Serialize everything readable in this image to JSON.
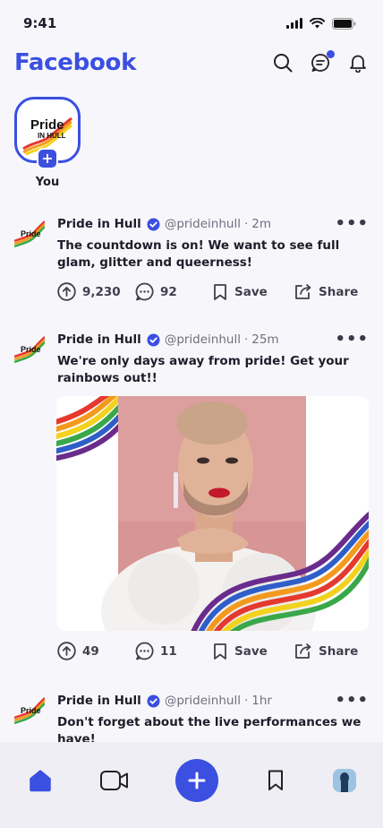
{
  "status": {
    "time": "9:41"
  },
  "header": {
    "brand": "Facebook",
    "icons": [
      "search-icon",
      "messages-icon",
      "bell-icon"
    ],
    "accent": "#3b4fe0"
  },
  "stories": [
    {
      "label": "You",
      "logo_text": "Pride IN HULL"
    }
  ],
  "posts": [
    {
      "author": "Pride in Hull",
      "handle": "@prideinhull",
      "age": "2m",
      "text": "The countdown is on! We want to see full glam, glitter and queerness!",
      "upvotes": "9,230",
      "comments": "92",
      "save_label": "Save",
      "share_label": "Share"
    },
    {
      "author": "Pride in Hull",
      "handle": "@prideinhull",
      "age": "25m",
      "text": "We're only days away from pride! Get your rainbows out!!",
      "upvotes": "49",
      "comments": "11",
      "save_label": "Save",
      "share_label": "Share"
    },
    {
      "author": "Pride in Hull",
      "handle": "@prideinhull",
      "age": "1hr",
      "text": "Don't forget about the live performances we have!"
    }
  ],
  "nav": {
    "items": [
      "home-icon",
      "video-icon",
      "create-icon",
      "bookmark-icon",
      "profile-avatar"
    ]
  }
}
